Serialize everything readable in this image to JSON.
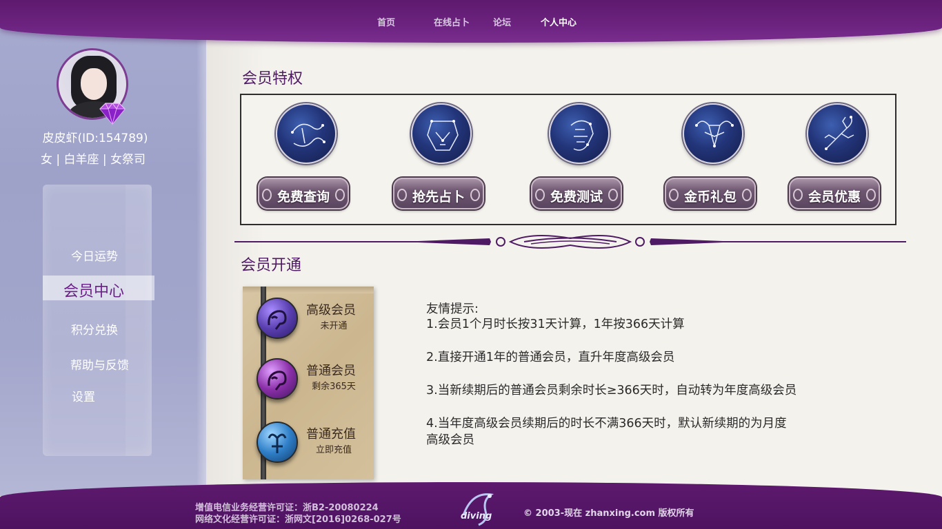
{
  "nav": {
    "items": [
      {
        "label": "首页"
      },
      {
        "label": "在线占卜"
      },
      {
        "label": "论坛"
      },
      {
        "label": "个人中心"
      }
    ]
  },
  "user": {
    "name": "皮皮虾(ID:154789)",
    "info": "女 | 白羊座 | 女祭司"
  },
  "sidebar": {
    "items": [
      {
        "label": "今日运势"
      },
      {
        "label": "会员中心"
      },
      {
        "label": "积分兑换"
      },
      {
        "label": "帮助与反馈"
      },
      {
        "label": "设置"
      }
    ],
    "active_index": 1
  },
  "privileges": {
    "title": "会员特权",
    "items": [
      {
        "label": "免费查询",
        "icon": "pisces-constellation-icon"
      },
      {
        "label": "抢先占卜",
        "icon": "leo-constellation-icon"
      },
      {
        "label": "免费测试",
        "icon": "aquarius-constellation-icon"
      },
      {
        "label": "金币礼包",
        "icon": "aries-constellation-icon"
      },
      {
        "label": "会员优惠",
        "icon": "scorpio-constellation-icon"
      }
    ]
  },
  "membership": {
    "title": "会员开通",
    "options": [
      {
        "name": "高级会员",
        "status": "未开通",
        "color": "#5a3fb0",
        "icon": "leo-icon"
      },
      {
        "name": "普通会员",
        "status": "剩余365天",
        "color": "#8a2fa8",
        "icon": "leo-icon"
      },
      {
        "name": "普通充值",
        "status": "立即充值",
        "color": "#2f7fc8",
        "icon": "aries-icon"
      }
    ]
  },
  "tips": {
    "heading": "友情提示:",
    "lines": [
      "1.会员1个月时长按31天计算，1年按366天计算",
      "2.直接开通1年的普通会员，直升年度高级会员",
      "3.当新续期后的普通会员剩余时长≥366天时，自动转为年度高级会员",
      "4.当年度高级会员续期后的时长不满366天时，默认新续期的为月度",
      "高级会员"
    ]
  },
  "footer": {
    "license1": "增值电信业务经营许可证：浙B2-20080224",
    "license2": "网络文化经营许可证：浙网文[2016]0268-027号",
    "logo_text": "diving",
    "copyright": "© 2003-现在 zhanxing.com 版权所有"
  },
  "colors": {
    "brand_purple": "#5e1a6e",
    "accent_purple": "#6a1f86",
    "sidebar": "#a3a6cb"
  }
}
